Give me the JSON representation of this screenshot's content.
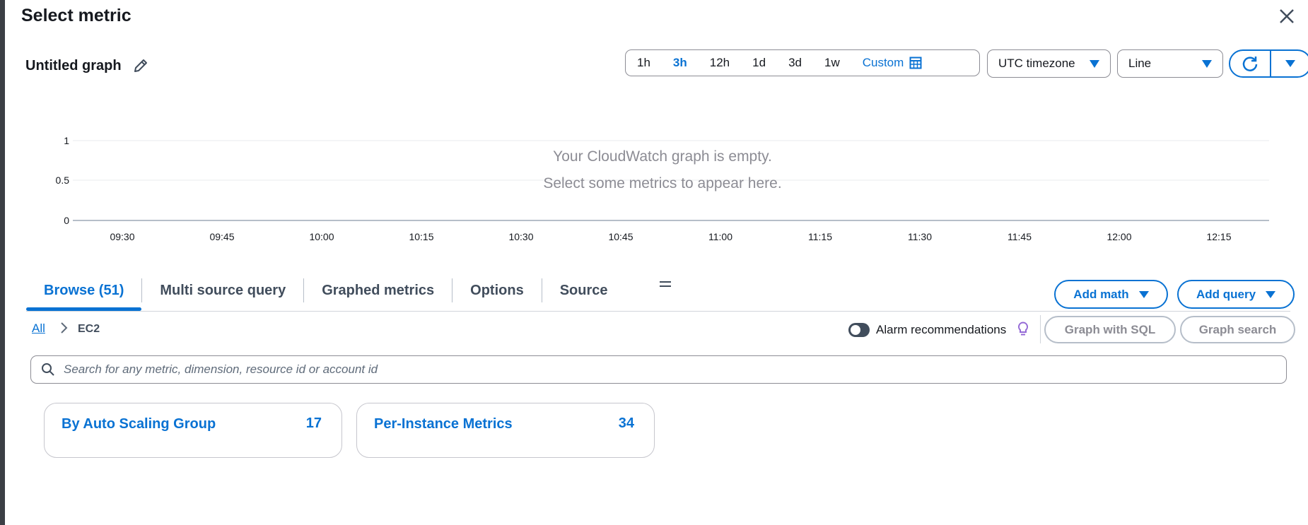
{
  "dialog": {
    "title": "Select metric"
  },
  "graph": {
    "title": "Untitled graph"
  },
  "time_range": {
    "options": [
      "1h",
      "3h",
      "12h",
      "1d",
      "3d",
      "1w"
    ],
    "active": "3h",
    "custom_label": "Custom"
  },
  "timezone": {
    "value": "UTC timezone"
  },
  "graph_type": {
    "value": "Line"
  },
  "chart_empty": {
    "line1": "Your CloudWatch graph is empty.",
    "line2": "Select some metrics to appear here.",
    "y_ticks": [
      "1",
      "0.5",
      "0"
    ],
    "x_ticks": [
      "09:30",
      "09:45",
      "10:00",
      "10:15",
      "10:30",
      "10:45",
      "11:00",
      "11:15",
      "11:30",
      "11:45",
      "12:00",
      "12:15"
    ]
  },
  "tabs": {
    "browse": "Browse (51)",
    "multi_source": "Multi source query",
    "graphed": "Graphed metrics",
    "options": "Options",
    "source": "Source"
  },
  "buttons": {
    "add_math": "Add math",
    "add_query": "Add query",
    "graph_sql": "Graph with SQL",
    "graph_search": "Graph search"
  },
  "breadcrumb": {
    "all": "All",
    "current": "EC2"
  },
  "alarm": {
    "label": "Alarm recommendations",
    "enabled": false
  },
  "search": {
    "placeholder": "Search for any metric, dimension, resource id or account id",
    "value": ""
  },
  "cards": [
    {
      "title": "By Auto Scaling Group",
      "count": "17"
    },
    {
      "title": "Per-Instance Metrics",
      "count": "34"
    }
  ],
  "colors": {
    "accent": "#0972d3",
    "text": "#16191f",
    "muted": "#8c8c94"
  }
}
